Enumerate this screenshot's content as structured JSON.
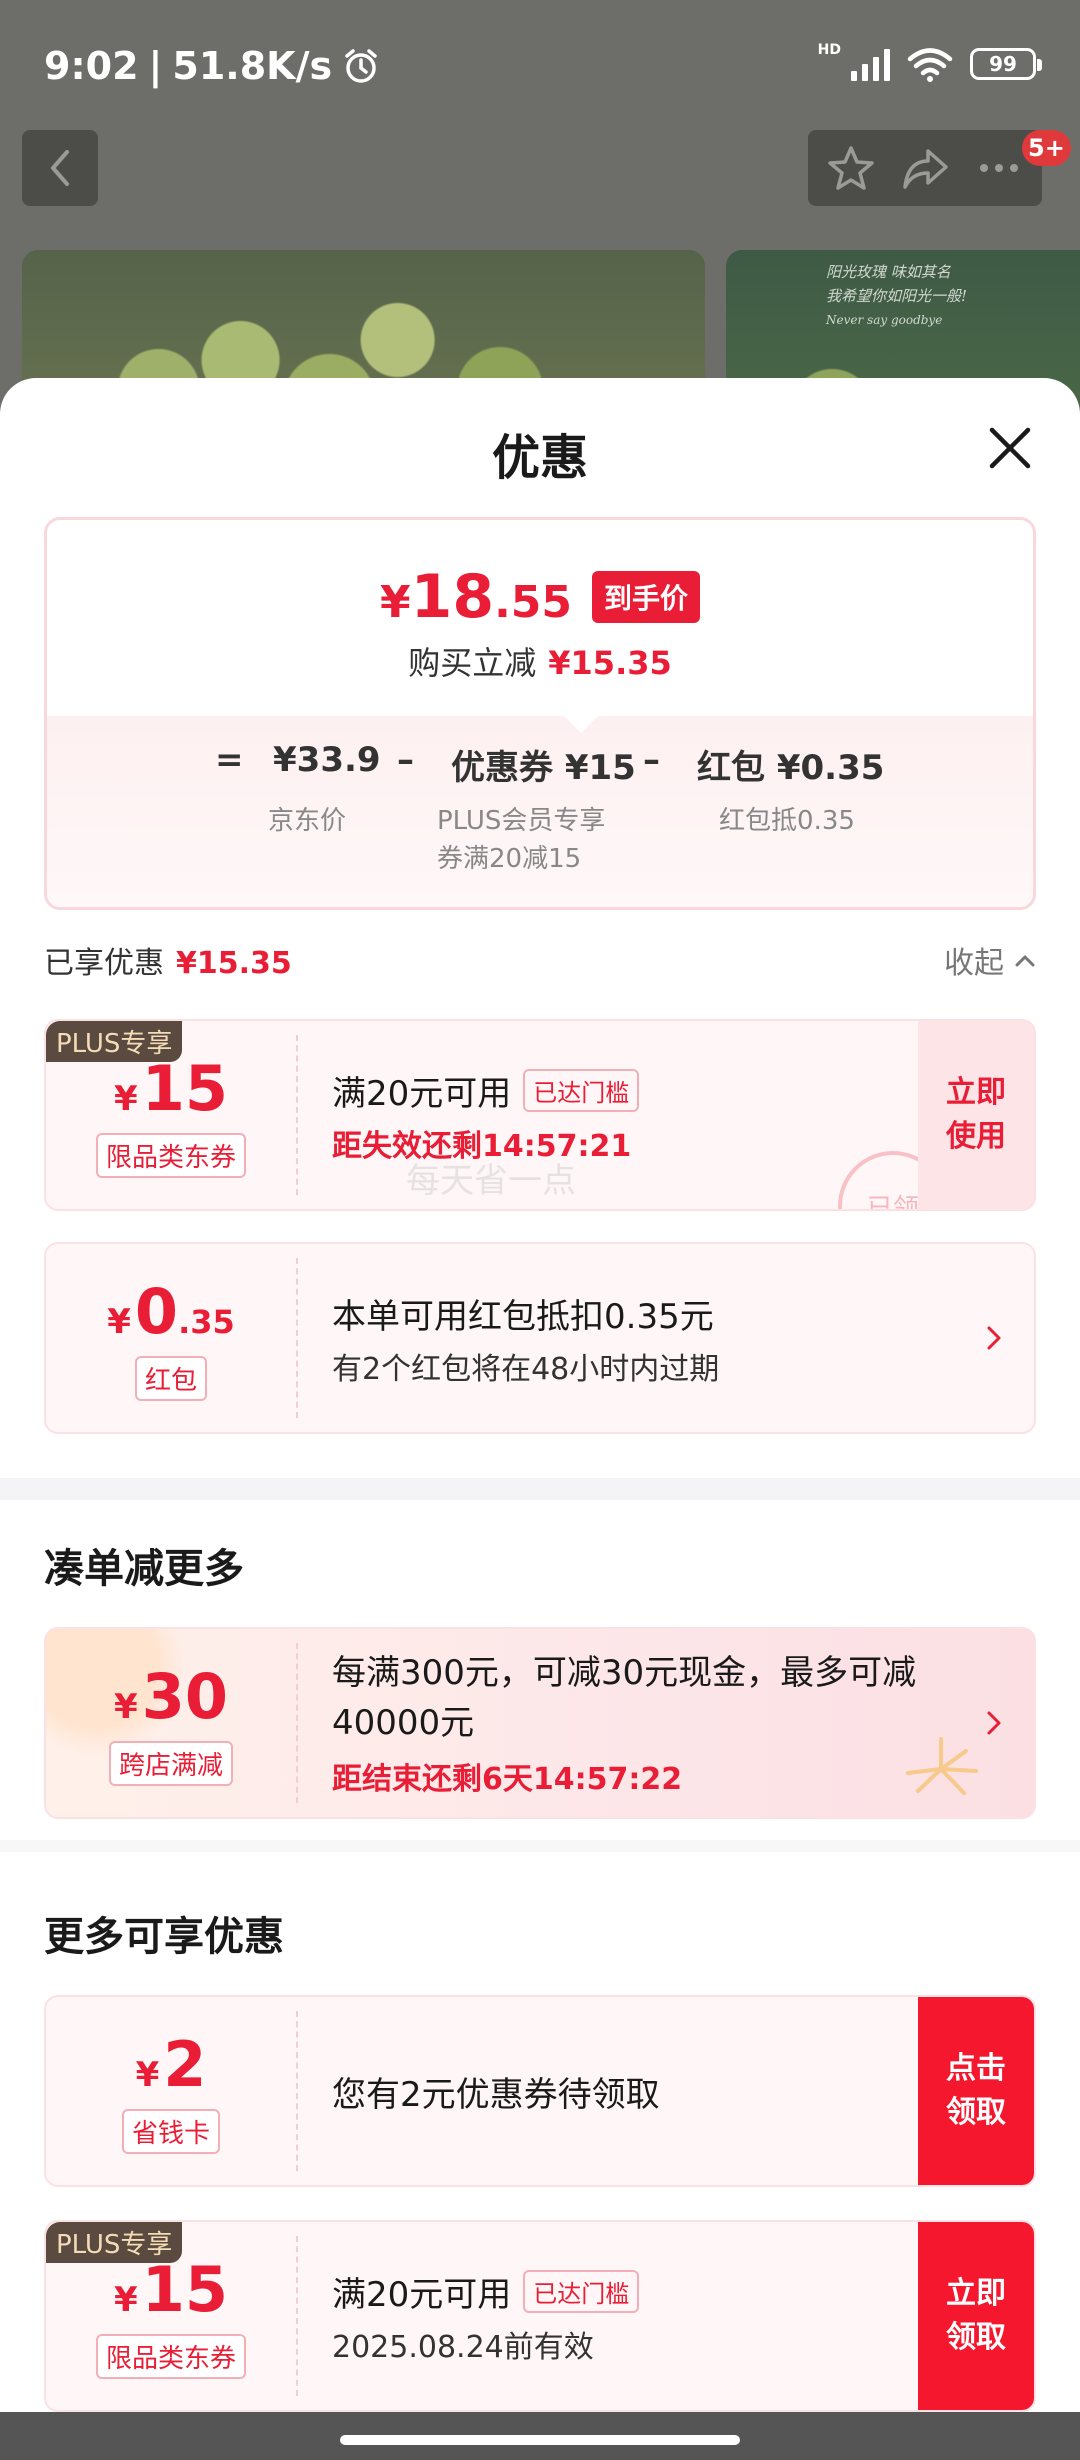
{
  "status_bar": {
    "time": "9:02",
    "net_speed": "51.8K/s",
    "battery": "99"
  },
  "header": {
    "more_badge": "5+"
  },
  "background_image": {
    "side_text_1": "阳光玫瑰 味如其名",
    "side_text_2": "我希望你如阳光一般!",
    "side_text_3": "Never say goodbye"
  },
  "sheet": {
    "title": "优惠"
  },
  "price_summary": {
    "yen": "¥",
    "final_int": "18",
    "final_dec": ".55",
    "final_tag": "到手价",
    "reduce_label": "购买立减",
    "reduce_value": "¥15.35",
    "eq": "=",
    "minus": "–",
    "items": [
      {
        "value": "¥33.9",
        "label": "京东价"
      },
      {
        "value": "优惠券 ¥15",
        "label": "PLUS会员专享\n券满20减15"
      },
      {
        "value": "红包 ¥0.35",
        "label": "红包抵0.35"
      }
    ]
  },
  "enjoyed": {
    "label": "已享优惠",
    "value": "¥15.35",
    "collapse_label": "收起"
  },
  "coupons": [
    {
      "badge": "PLUS专享",
      "yen": "¥",
      "amount_int": "15",
      "amount_dec": "",
      "type": "限品类东券",
      "title": "满20元可用",
      "threshold": "已达门槛",
      "subtitle": "距失效还剩14:57:21",
      "action": "立即使用",
      "watermark": "每天省一点",
      "stamp": "已领"
    },
    {
      "yen": "¥",
      "amount_int": "0",
      "amount_dec": ".35",
      "type": "红包",
      "title": "本单可用红包抵扣0.35元",
      "subtitle": "有2个红包将在48小时内过期"
    }
  ],
  "section_more_deals": {
    "title": "凑单减更多",
    "promo": {
      "yen": "¥",
      "amount": "30",
      "type": "跨店满减",
      "title": "每满300元，可减30元现金，最多可减40000元",
      "subtitle": "距结束还剩6天14:57:22"
    }
  },
  "section_more_offers": {
    "title": "更多可享优惠",
    "items": [
      {
        "yen": "¥",
        "amount": "2",
        "type": "省钱卡",
        "title": "您有2元优惠券待领取",
        "action": "点击领取"
      },
      {
        "badge": "PLUS专享",
        "yen": "¥",
        "amount": "15",
        "type": "限品类东券",
        "title": "满20元可用",
        "threshold": "已达门槛",
        "subtitle": "2025.08.24前有效",
        "action": "立即领取"
      }
    ]
  },
  "colors": {
    "accent_red": "#e91e36",
    "action_red": "#f5172d",
    "plus_badge_bg": "#5a4a3f"
  }
}
